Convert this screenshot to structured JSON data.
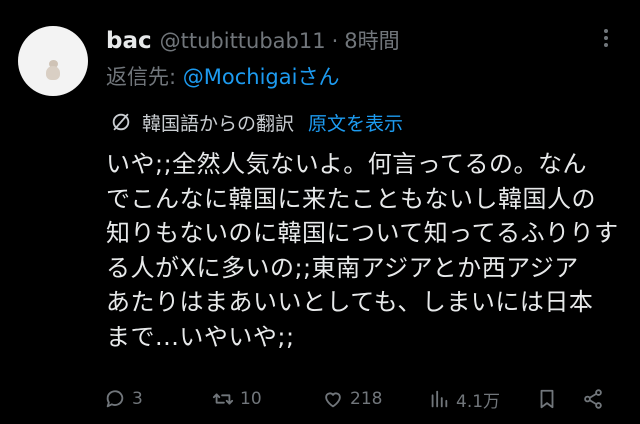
{
  "tweet": {
    "display_name": "bac",
    "handle": "@ttubittubab11",
    "separator": "·",
    "time": "8時間",
    "reply_prefix": "返信先:",
    "reply_user": "@Mochigaiさん",
    "translation_label": "韓国語からの翻訳",
    "show_original": "原文を表示",
    "body_lines": [
      "いや;;全然人気ないよ。何言ってるの。なん",
      "でこんなに韓国に来たこともないし韓国人の",
      "知りもないのに韓国について知ってるふりりす",
      "る人がXに多いの;;東南アジアとか西アジア",
      "あたりはまあいいとしても、しまいには日本",
      "まで...いやいや;;"
    ]
  },
  "actions": {
    "replies": "3",
    "reposts": "10",
    "likes": "218",
    "views": "4.1万"
  },
  "icons": {
    "avatar": "avatar",
    "more": "more-options-icon",
    "translate": "translate-icon",
    "reply": "reply-icon",
    "repost": "repost-icon",
    "like": "heart-icon",
    "views": "views-chart-icon",
    "bookmark": "bookmark-icon",
    "share": "share-icon"
  },
  "colors": {
    "background": "#000000",
    "text": "#e7e9ea",
    "muted": "#71767b",
    "accent": "#1d9bf0"
  }
}
